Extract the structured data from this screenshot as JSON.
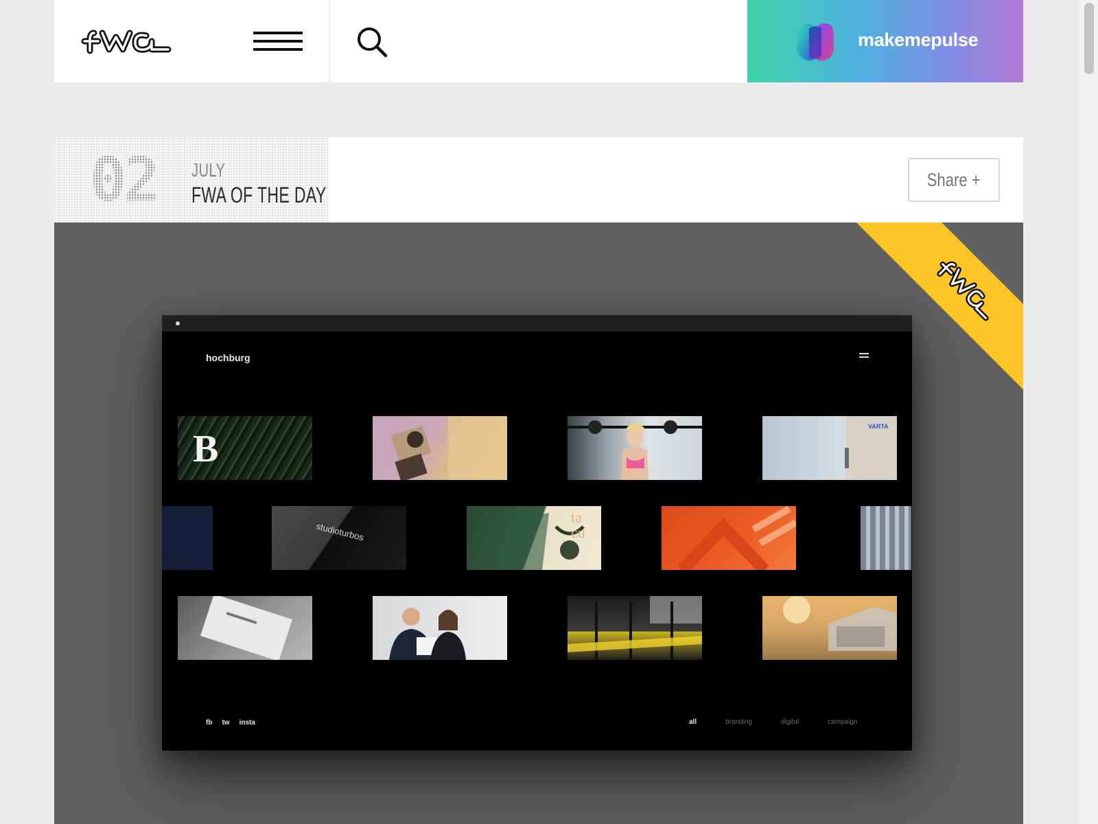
{
  "header": {
    "logo_label": "FWA",
    "sponsor_name": "makemepulse"
  },
  "entry": {
    "day": "02",
    "month": "JULY",
    "title": "FWA OF THE DAY",
    "share_label": "Share +"
  },
  "showcase": {
    "site_name": "hochburg",
    "tile_texts": {
      "varta": "VARTA",
      "studio": "studioturbos",
      "cup": "ta cu"
    },
    "footer_links": [
      "fb",
      "tw",
      "insta"
    ],
    "filters": [
      "all",
      "branding",
      "digital",
      "campaign"
    ],
    "active_filter": "all"
  },
  "colors": {
    "ribbon": "#fdc526",
    "sponsor_gradient_start": "#3fd5a6",
    "sponsor_gradient_end": "#b47ad6",
    "showcase_bg": "#606060"
  }
}
